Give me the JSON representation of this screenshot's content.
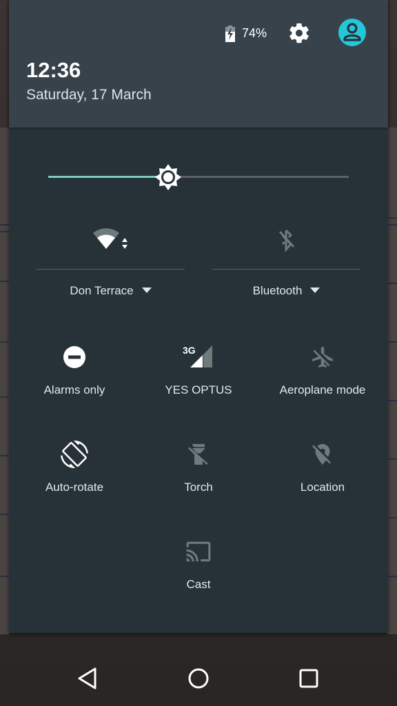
{
  "status": {
    "battery_percent": "74%",
    "battery_charging": true
  },
  "header": {
    "time": "12:36",
    "date": "Saturday, 17 March",
    "settings_icon": "gear-icon",
    "user_icon": "account-circle-icon"
  },
  "brightness": {
    "level_fraction": 0.4,
    "icon": "brightness-icon"
  },
  "big_tiles": [
    {
      "label": "Don Terrace",
      "icon": "wifi-icon",
      "state": "on",
      "has_dropdown": true
    },
    {
      "label": "Bluetooth",
      "icon": "bluetooth-off-icon",
      "state": "off",
      "has_dropdown": true
    }
  ],
  "tiles": [
    {
      "label": "Alarms only",
      "icon": "do-not-disturb-icon",
      "state": "on"
    },
    {
      "label": "YES OPTUS",
      "icon": "cellular-3g-icon",
      "network_type": "3G",
      "state": "on"
    },
    {
      "label": "Aeroplane mode",
      "icon": "airplane-off-icon",
      "state": "off"
    },
    {
      "label": "Auto-rotate",
      "icon": "screen-rotation-icon",
      "state": "on"
    },
    {
      "label": "Torch",
      "icon": "flashlight-off-icon",
      "state": "off"
    },
    {
      "label": "Location",
      "icon": "location-off-icon",
      "state": "off"
    },
    {
      "label": "Cast",
      "icon": "cast-icon",
      "state": "off"
    }
  ],
  "colors": {
    "accent": "#80cbc4",
    "avatar": "#26c6da",
    "panel": "#263238",
    "header": "#37424a",
    "icon_on": "#ffffff",
    "icon_off": "#6f7a7d"
  },
  "navigation": {
    "back": "back-icon",
    "home": "home-icon",
    "recents": "recents-icon"
  }
}
